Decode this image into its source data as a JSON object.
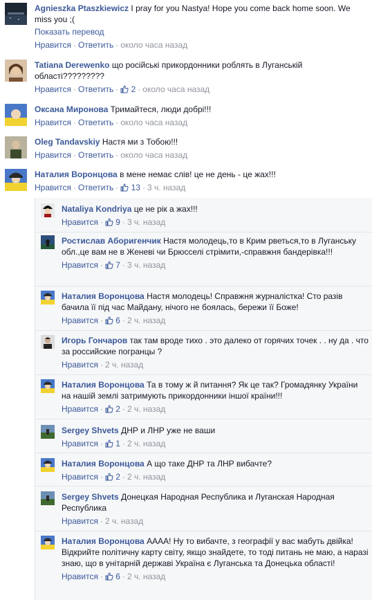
{
  "labels": {
    "like": "Нравится",
    "reply": "Ответить",
    "translate": "Показать перевод"
  },
  "comments": [
    {
      "author": "Agnieszka Ptaszkiewicz",
      "text": "I pray for you Nastya! Hope you come back home soon. We miss you ;(",
      "time": "около часа назад"
    },
    {
      "author": "Tatiana Derewenko",
      "text": "що російські прикордонники роблять в Луганській області?????????",
      "likes": "2",
      "time": "около часа назад"
    },
    {
      "author": "Оксана Миронова",
      "text": "Тримайтеся, люди добрі!!!",
      "time": "около часа назад"
    },
    {
      "author": "Oleg Tandavskiy",
      "text": "Настя ми з Тобою!!!",
      "time": "около часа назад"
    },
    {
      "author": "Наталия Воронцова",
      "text": "в мене немає слів! це не день - це жах!!!",
      "likes": "13",
      "time": "3 ч. назад"
    }
  ],
  "replies": [
    {
      "author": "Nataliya Kondriya",
      "text": "це не рік а жах!!!",
      "likes": "9",
      "time": "3 ч. назад"
    },
    {
      "author": "Ростислав Аборигенчик",
      "text": "Настя молодець,то в Крим рветься,то в Луганську обл.,це вам не в Женеві чи Брюсселі стрімити,-справжня бандерівка!!!",
      "likes": "7",
      "time": "3 ч. назад"
    },
    {
      "author": "Наталия Воронцова",
      "text": "Настя молодець! Справжня журналістка! Сто разів бачила її під час Майдану, нічого не боялась, бережи її Боже!",
      "likes": "6",
      "time": "2 ч. назад"
    },
    {
      "author": "Игорь Гончаров",
      "text": "так там вроде тихо . это далеко от горячих точек . . ну да . что за российские погранцы ?",
      "time": "2 ч. назад"
    },
    {
      "author": "Наталия Воронцова",
      "text": "Та в тому ж й питання? Як це так? Громадянку України на нашій землі затримують прикордонники іншої країни!!!",
      "likes": "2",
      "time": "2 ч. назад"
    },
    {
      "author": "Sergey Shvets",
      "text": "ДНР и ЛНР уже не ваши",
      "likes": "1",
      "time": "2 ч. назад"
    },
    {
      "author": "Наталия Воронцова",
      "text": "А що таке ДНР та ЛНР вибачте?",
      "likes": "2",
      "time": "2 ч. назад"
    },
    {
      "author": "Sergey Shvets",
      "text": "Донецкая Народная Республика и Луганская Народная Республика",
      "time": "2 ч. назад"
    },
    {
      "author": "Наталия Воронцова",
      "text": "АААА! Ну то вибачте, з географії у вас мабуть двійка! Відкрийте політичну карту світу, якщо знайдете, то тоді питань не маю, а наразі знаю, що в унітарній державі Україна є Луганська та Донецька області!",
      "likes": "6",
      "time": "2 ч. назад"
    }
  ]
}
